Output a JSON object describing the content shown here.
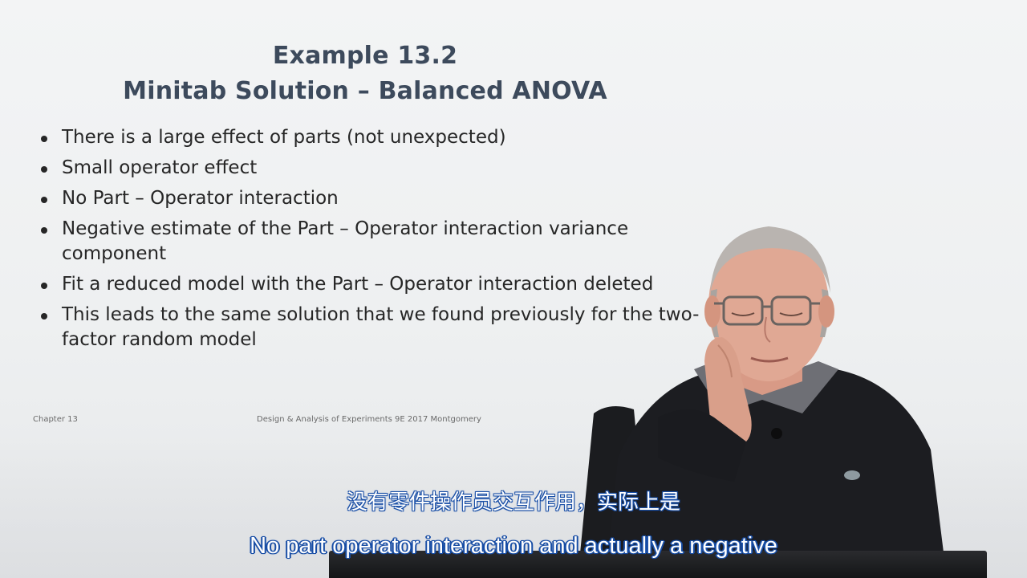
{
  "slide": {
    "title_line1": "Example 13.2",
    "title_line2": "Minitab Solution – Balanced ANOVA",
    "bullets": [
      "There is a large effect of parts (not unexpected)",
      "Small operator effect",
      "No Part – Operator interaction",
      "Negative estimate of the Part – Operator interaction variance component",
      "Fit a reduced model with the Part – Operator interaction deleted",
      "This leads to the same solution that we found previously for the two-factor random model"
    ],
    "footer_left": "Chapter 13",
    "footer_center": "Design & Analysis of Experiments 9E 2017 Montgomery"
  },
  "subtitles": {
    "chinese": "没有零件操作员交互作用，实际上是",
    "english": "No part operator interaction and actually a negative"
  },
  "colors": {
    "title": "#3d4a5c",
    "body_text": "#262626",
    "subtitle_text": "#ffffff",
    "subtitle_outline": "#1a4fa6"
  },
  "icons": {
    "bullet": "bullet-dot-icon"
  }
}
